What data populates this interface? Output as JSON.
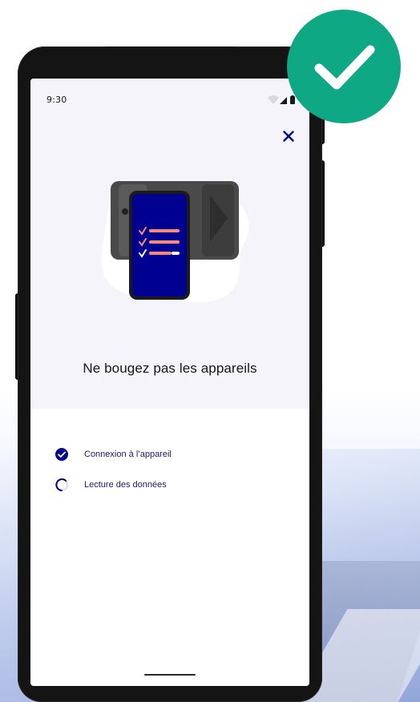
{
  "status_bar": {
    "time": "9:30",
    "icons": [
      "wifi-icon",
      "cell-signal-icon",
      "battery-icon"
    ]
  },
  "header": {
    "close_icon": "close-icon"
  },
  "illustration": {
    "name": "phone-reading-device-illustration"
  },
  "main": {
    "title": "Ne bougez pas les appareils"
  },
  "steps": [
    {
      "label": "Connexion à l’appareil",
      "state": "done",
      "icon": "check-circle-icon"
    },
    {
      "label": "Lecture des données",
      "state": "in-progress",
      "icon": "spinner-icon"
    }
  ],
  "badge": {
    "icon": "checkmark-icon"
  },
  "colors": {
    "accent_blue": "#000091",
    "check_green": "#0fa885",
    "hero_bg": "#f4f4fa",
    "step_text": "#1b1b66"
  }
}
